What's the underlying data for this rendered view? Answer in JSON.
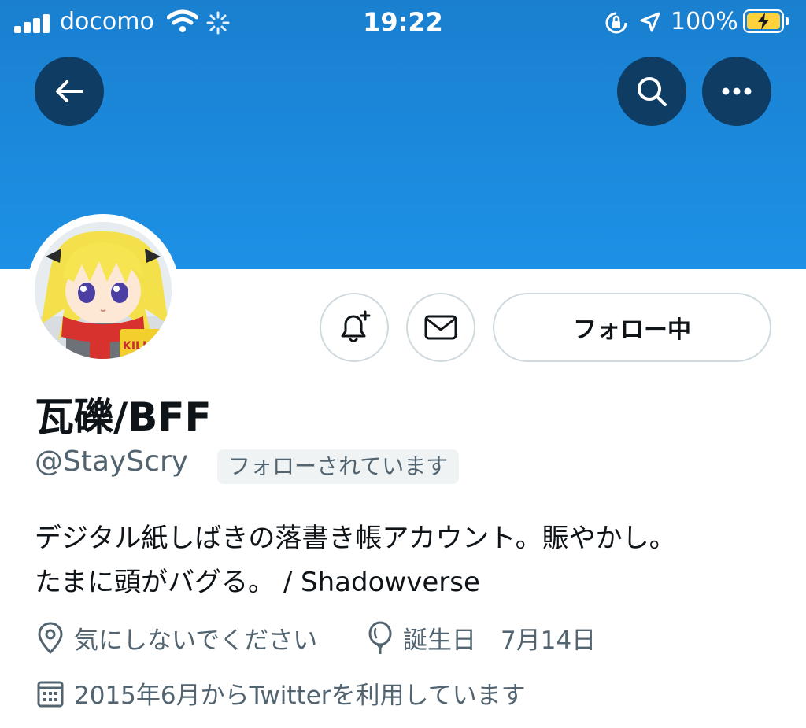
{
  "status_bar": {
    "carrier": "docomo",
    "time": "19:22",
    "battery": "100%"
  },
  "header": {
    "back_icon": "arrow-left-icon",
    "search_icon": "search-icon",
    "more_icon": "more-horizontal-icon"
  },
  "profile": {
    "avatar_art": "KILLMEBABY",
    "follow_button": "フォロー中",
    "display_name": "瓦礫/BFF",
    "handle": "@StayScry",
    "follows_you": "フォローされています",
    "bio_line1": "デジタル紙しばきの落書き帳アカウント。賑やかし。",
    "bio_line2": "たまに頭がバグる。 / Shadowverse",
    "location": "気にしないでください",
    "birthday": "誕生日　7月14日",
    "joined": "2015年6月からTwitterを利用しています"
  },
  "colors": {
    "banner": "#1d91e6",
    "button_dark": "#0f3c62",
    "secondary_text": "#536471"
  }
}
